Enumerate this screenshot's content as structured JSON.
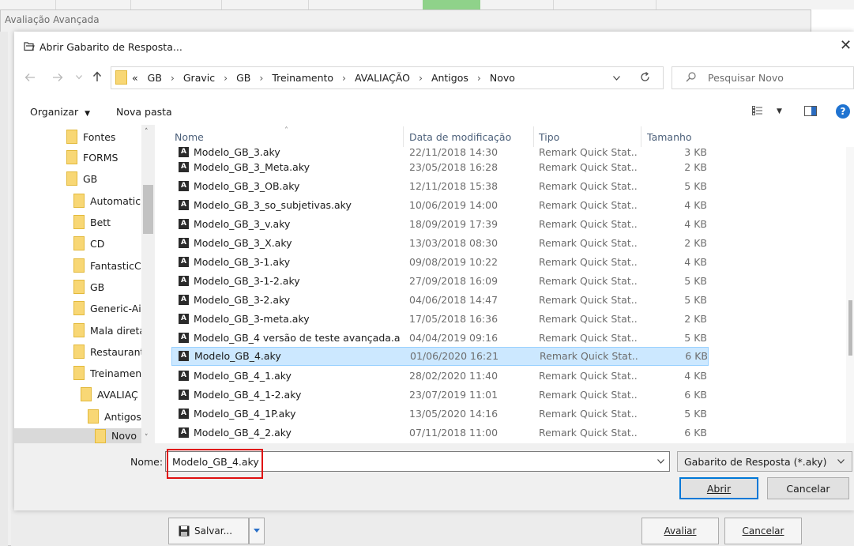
{
  "background_window": {
    "title": "Avaliação Avançada",
    "save_button": "Salvar...",
    "evaluate_button": "Avaliar",
    "cancel_button": "Cancelar"
  },
  "dialog": {
    "title": "Abrir Gabarito de Resposta...",
    "close_glyph": "✕",
    "breadcrumb": {
      "prefix": "«",
      "parts": [
        "GB",
        "Gravic",
        "GB",
        "Treinamento",
        "AVALIAÇÃO",
        "Antigos",
        "Novo"
      ],
      "separator": "›"
    },
    "search_placeholder": "Pesquisar Novo",
    "toolbar": {
      "organize": "Organizar",
      "new_folder": "Nova pasta"
    },
    "nav_pane": {
      "items": [
        "Fontes",
        "FORMS",
        "GB",
        "Automatic",
        "Bett",
        "CD",
        "FantasticC",
        "GB",
        "Generic-Ai",
        "Mala direta",
        "Restaurant",
        "Treinamen",
        "AVALIAÇ",
        "Antigos",
        "Novo"
      ]
    },
    "columns": {
      "name": "Nome",
      "date": "Data de modificação",
      "type": "Tipo",
      "size": "Tamanho"
    },
    "files": [
      {
        "name": "Modelo_GB_3.aky",
        "date": "22/11/2018 14:30",
        "type": "Remark Quick Stat...",
        "size": "3 KB"
      },
      {
        "name": "Modelo_GB_3_Meta.aky",
        "date": "23/05/2018 16:28",
        "type": "Remark Quick Stat...",
        "size": "2 KB"
      },
      {
        "name": "Modelo_GB_3_OB.aky",
        "date": "12/11/2018 15:38",
        "type": "Remark Quick Stat...",
        "size": "5 KB"
      },
      {
        "name": "Modelo_GB_3_so_subjetivas.aky",
        "date": "10/06/2019 14:00",
        "type": "Remark Quick Stat...",
        "size": "4 KB"
      },
      {
        "name": "Modelo_GB_3_v.aky",
        "date": "18/09/2019 17:39",
        "type": "Remark Quick Stat...",
        "size": "4 KB"
      },
      {
        "name": "Modelo_GB_3_X.aky",
        "date": "13/03/2018 08:30",
        "type": "Remark Quick Stat...",
        "size": "2 KB"
      },
      {
        "name": "Modelo_GB_3-1.aky",
        "date": "09/08/2019 10:22",
        "type": "Remark Quick Stat...",
        "size": "4 KB"
      },
      {
        "name": "Modelo_GB_3-1-2.aky",
        "date": "27/09/2018 16:09",
        "type": "Remark Quick Stat...",
        "size": "5 KB"
      },
      {
        "name": "Modelo_GB_3-2.aky",
        "date": "04/06/2018 14:47",
        "type": "Remark Quick Stat...",
        "size": "5 KB"
      },
      {
        "name": "Modelo_GB_3-meta.aky",
        "date": "17/05/2018 16:36",
        "type": "Remark Quick Stat...",
        "size": "2 KB"
      },
      {
        "name": "Modelo_GB_4 versão de teste avançada.a...",
        "date": "04/04/2019 09:16",
        "type": "Remark Quick Stat...",
        "size": "5 KB"
      },
      {
        "name": "Modelo_GB_4.aky",
        "date": "01/06/2020 16:21",
        "type": "Remark Quick Stat...",
        "size": "6 KB"
      },
      {
        "name": "Modelo_GB_4_1.aky",
        "date": "28/02/2020 11:40",
        "type": "Remark Quick Stat...",
        "size": "4 KB"
      },
      {
        "name": "Modelo_GB_4_1-2.aky",
        "date": "23/07/2019 11:01",
        "type": "Remark Quick Stat...",
        "size": "6 KB"
      },
      {
        "name": "Modelo_GB_4_1P.aky",
        "date": "13/05/2020 14:16",
        "type": "Remark Quick Stat...",
        "size": "5 KB"
      },
      {
        "name": "Modelo_GB_4_2.aky",
        "date": "07/11/2018 11:00",
        "type": "Remark Quick Stat...",
        "size": "6 KB"
      }
    ],
    "filename_label": "Nome:",
    "filename_value": "Modelo_GB_4.aky",
    "filter_value": "Gabarito de Resposta (*.aky)",
    "open_button": "Abrir",
    "cancel_button": "Cancelar",
    "accent_color": "#0078d7",
    "selection_color": "#cce8ff",
    "highlight_color": "#e01010"
  }
}
